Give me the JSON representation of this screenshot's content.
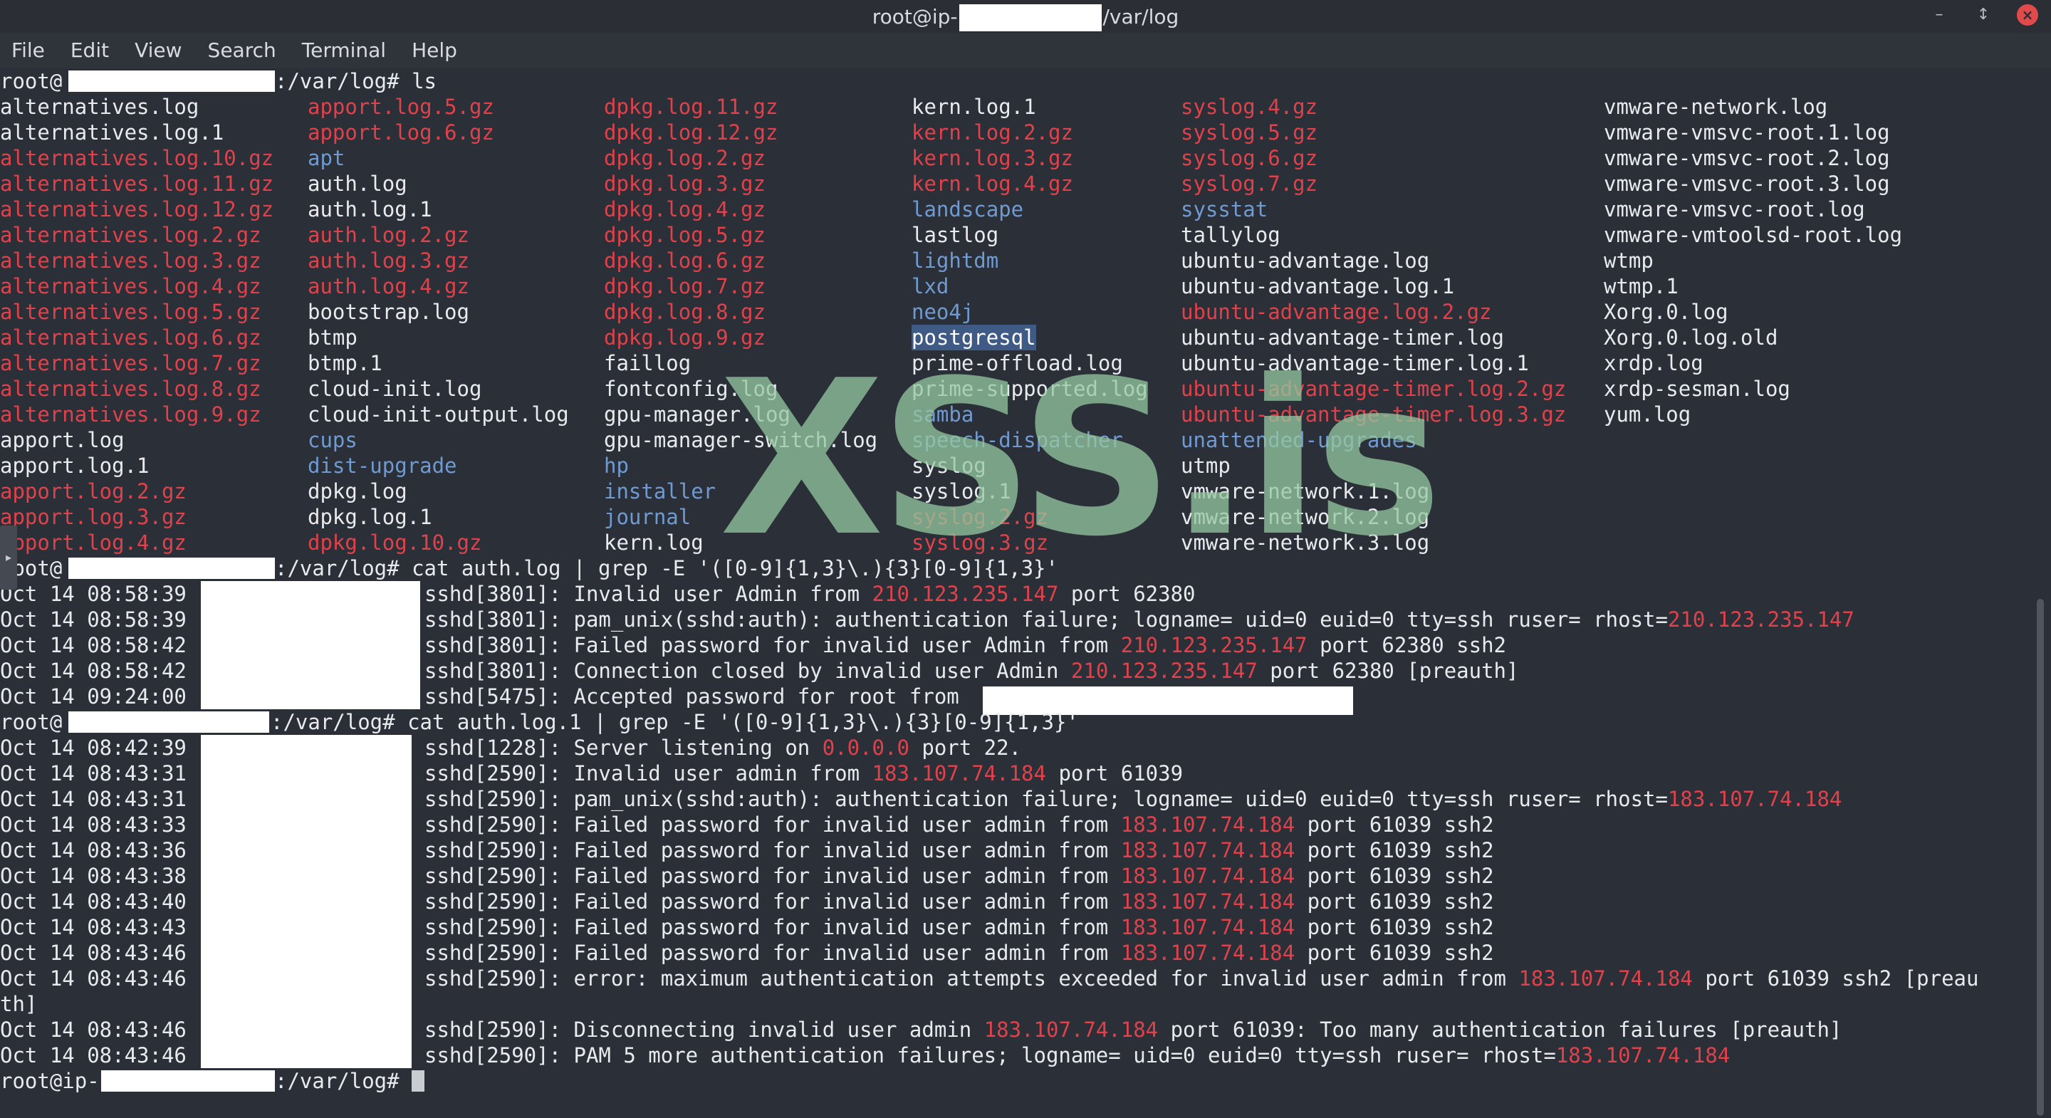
{
  "window": {
    "title_prefix": "root@ip-",
    "title_suffix": "/var/log",
    "minimize_glyph": "–",
    "maximize_glyph": "↕",
    "close_glyph": "×"
  },
  "menu": [
    "File",
    "Edit",
    "View",
    "Search",
    "Terminal",
    "Help"
  ],
  "colors": {
    "background": "#2b3038",
    "text": "#e8eaed",
    "red": "#e0414a",
    "blue": "#6f9ad2",
    "selection": "#3f5a85"
  },
  "watermark": "XSS.is",
  "ls_prompt": {
    "user": "root@",
    "path": ":/var/log",
    "hash": "# ",
    "command": "ls"
  },
  "ls_columns": [
    [
      {
        "t": "alternatives.log",
        "c": "w"
      },
      {
        "t": "alternatives.log.1",
        "c": "w"
      },
      {
        "t": "alternatives.log.10.gz",
        "c": "r"
      },
      {
        "t": "alternatives.log.11.gz",
        "c": "r"
      },
      {
        "t": "alternatives.log.12.gz",
        "c": "r"
      },
      {
        "t": "alternatives.log.2.gz",
        "c": "r"
      },
      {
        "t": "alternatives.log.3.gz",
        "c": "r"
      },
      {
        "t": "alternatives.log.4.gz",
        "c": "r"
      },
      {
        "t": "alternatives.log.5.gz",
        "c": "r"
      },
      {
        "t": "alternatives.log.6.gz",
        "c": "r"
      },
      {
        "t": "alternatives.log.7.gz",
        "c": "r"
      },
      {
        "t": "alternatives.log.8.gz",
        "c": "r"
      },
      {
        "t": "alternatives.log.9.gz",
        "c": "r"
      },
      {
        "t": "apport.log",
        "c": "w"
      },
      {
        "t": "apport.log.1",
        "c": "w"
      },
      {
        "t": "apport.log.2.gz",
        "c": "r"
      },
      {
        "t": "apport.log.3.gz",
        "c": "r"
      },
      {
        "t": "apport.log.4.gz",
        "c": "r"
      }
    ],
    [
      {
        "t": "apport.log.5.gz",
        "c": "r"
      },
      {
        "t": "apport.log.6.gz",
        "c": "r"
      },
      {
        "t": "apt",
        "c": "b"
      },
      {
        "t": "auth.log",
        "c": "w"
      },
      {
        "t": "auth.log.1",
        "c": "w"
      },
      {
        "t": "auth.log.2.gz",
        "c": "r"
      },
      {
        "t": "auth.log.3.gz",
        "c": "r"
      },
      {
        "t": "auth.log.4.gz",
        "c": "r"
      },
      {
        "t": "bootstrap.log",
        "c": "w"
      },
      {
        "t": "btmp",
        "c": "w"
      },
      {
        "t": "btmp.1",
        "c": "w"
      },
      {
        "t": "cloud-init.log",
        "c": "w"
      },
      {
        "t": "cloud-init-output.log",
        "c": "w"
      },
      {
        "t": "cups",
        "c": "b"
      },
      {
        "t": "dist-upgrade",
        "c": "b"
      },
      {
        "t": "dpkg.log",
        "c": "w"
      },
      {
        "t": "dpkg.log.1",
        "c": "w"
      },
      {
        "t": "dpkg.log.10.gz",
        "c": "r"
      }
    ],
    [
      {
        "t": "dpkg.log.11.gz",
        "c": "r"
      },
      {
        "t": "dpkg.log.12.gz",
        "c": "r"
      },
      {
        "t": "dpkg.log.2.gz",
        "c": "r"
      },
      {
        "t": "dpkg.log.3.gz",
        "c": "r"
      },
      {
        "t": "dpkg.log.4.gz",
        "c": "r"
      },
      {
        "t": "dpkg.log.5.gz",
        "c": "r"
      },
      {
        "t": "dpkg.log.6.gz",
        "c": "r"
      },
      {
        "t": "dpkg.log.7.gz",
        "c": "r"
      },
      {
        "t": "dpkg.log.8.gz",
        "c": "r"
      },
      {
        "t": "dpkg.log.9.gz",
        "c": "r"
      },
      {
        "t": "faillog",
        "c": "w"
      },
      {
        "t": "fontconfig.log",
        "c": "w"
      },
      {
        "t": "gpu-manager.log",
        "c": "w"
      },
      {
        "t": "gpu-manager-switch.log",
        "c": "w"
      },
      {
        "t": "hp",
        "c": "b"
      },
      {
        "t": "installer",
        "c": "b"
      },
      {
        "t": "journal",
        "c": "b"
      },
      {
        "t": "kern.log",
        "c": "w"
      }
    ],
    [
      {
        "t": "kern.log.1",
        "c": "w"
      },
      {
        "t": "kern.log.2.gz",
        "c": "r"
      },
      {
        "t": "kern.log.3.gz",
        "c": "r"
      },
      {
        "t": "kern.log.4.gz",
        "c": "r"
      },
      {
        "t": "landscape",
        "c": "b"
      },
      {
        "t": "lastlog",
        "c": "w"
      },
      {
        "t": "lightdm",
        "c": "b"
      },
      {
        "t": "lxd",
        "c": "b"
      },
      {
        "t": "neo4j",
        "c": "b"
      },
      {
        "t": "postgresql",
        "c": "sel"
      },
      {
        "t": "prime-offload.log",
        "c": "w"
      },
      {
        "t": "prime-supported.log",
        "c": "w"
      },
      {
        "t": "samba",
        "c": "b"
      },
      {
        "t": "speech-dispatcher",
        "c": "b"
      },
      {
        "t": "syslog",
        "c": "w"
      },
      {
        "t": "syslog.1",
        "c": "w"
      },
      {
        "t": "syslog.2.gz",
        "c": "r"
      },
      {
        "t": "syslog.3.gz",
        "c": "r"
      }
    ],
    [
      {
        "t": "syslog.4.gz",
        "c": "r"
      },
      {
        "t": "syslog.5.gz",
        "c": "r"
      },
      {
        "t": "syslog.6.gz",
        "c": "r"
      },
      {
        "t": "syslog.7.gz",
        "c": "r"
      },
      {
        "t": "sysstat",
        "c": "b"
      },
      {
        "t": "tallylog",
        "c": "w"
      },
      {
        "t": "ubuntu-advantage.log",
        "c": "w"
      },
      {
        "t": "ubuntu-advantage.log.1",
        "c": "w"
      },
      {
        "t": "ubuntu-advantage.log.2.gz",
        "c": "r"
      },
      {
        "t": "ubuntu-advantage-timer.log",
        "c": "w"
      },
      {
        "t": "ubuntu-advantage-timer.log.1",
        "c": "w"
      },
      {
        "t": "ubuntu-advantage-timer.log.2.gz",
        "c": "r"
      },
      {
        "t": "ubuntu-advantage-timer.log.3.gz",
        "c": "r"
      },
      {
        "t": "unattended-upgrades",
        "c": "b"
      },
      {
        "t": "utmp",
        "c": "w"
      },
      {
        "t": "vmware-network.1.log",
        "c": "w"
      },
      {
        "t": "vmware-network.2.log",
        "c": "w"
      },
      {
        "t": "vmware-network.3.log",
        "c": "w"
      }
    ],
    [
      {
        "t": "vmware-network.log",
        "c": "w"
      },
      {
        "t": "vmware-vmsvc-root.1.log",
        "c": "w"
      },
      {
        "t": "vmware-vmsvc-root.2.log",
        "c": "w"
      },
      {
        "t": "vmware-vmsvc-root.3.log",
        "c": "w"
      },
      {
        "t": "vmware-vmsvc-root.log",
        "c": "w"
      },
      {
        "t": "vmware-vmtoolsd-root.log",
        "c": "w"
      },
      {
        "t": "wtmp",
        "c": "w"
      },
      {
        "t": "wtmp.1",
        "c": "w"
      },
      {
        "t": "Xorg.0.log",
        "c": "w"
      },
      {
        "t": "Xorg.0.log.old",
        "c": "w"
      },
      {
        "t": "xrdp.log",
        "c": "w"
      },
      {
        "t": "xrdp-sesman.log",
        "c": "w"
      },
      {
        "t": "yum.log",
        "c": "w"
      }
    ]
  ],
  "grep1_prompt": {
    "user": "root@",
    "path": ":/var/log",
    "hash": "# ",
    "command": "cat auth.log | grep -E '([0-9]{1,3}\\.){3}[0-9]{1,3}'"
  },
  "grep1_lines": [
    {
      "ts": "Oct 14 08:58:39",
      "segs": [
        {
          "t": "sshd[3801]: Invalid user Admin from ",
          "c": "w"
        },
        {
          "t": "210.123.235.147",
          "c": "r"
        },
        {
          "t": " port 62380",
          "c": "w"
        }
      ]
    },
    {
      "ts": "Oct 14 08:58:39",
      "segs": [
        {
          "t": "sshd[3801]: pam_unix(sshd:auth): authentication failure; logname= uid=0 euid=0 tty=ssh ruser= rhost=",
          "c": "w"
        },
        {
          "t": "210.123.235.147",
          "c": "r"
        }
      ]
    },
    {
      "ts": "Oct 14 08:58:42",
      "segs": [
        {
          "t": "sshd[3801]: Failed password for invalid user Admin from ",
          "c": "w"
        },
        {
          "t": "210.123.235.147",
          "c": "r"
        },
        {
          "t": " port 62380 ssh2",
          "c": "w"
        }
      ]
    },
    {
      "ts": "Oct 14 08:58:42",
      "segs": [
        {
          "t": "sshd[3801]: Connection closed by invalid user Admin ",
          "c": "w"
        },
        {
          "t": "210.123.235.147",
          "c": "r"
        },
        {
          "t": " port 62380 [preauth]",
          "c": "w"
        }
      ]
    },
    {
      "ts": "Oct 14 09:24:00",
      "segs": [
        {
          "t": "sshd[5475]: Accepted password for root from ",
          "c": "w"
        }
      ]
    }
  ],
  "grep2_prompt": {
    "user": "root@",
    "path": ":/var/log",
    "hash": "# ",
    "command": "cat auth.log.1 | grep -E '([0-9]{1,3}\\.){3}[0-9]{1,3}'"
  },
  "grep2_lines": [
    {
      "ts": "Oct 14 08:42:39",
      "segs": [
        {
          "t": "sshd[1228]: Server listening on ",
          "c": "w"
        },
        {
          "t": "0.0.0.0",
          "c": "r"
        },
        {
          "t": " port 22.",
          "c": "w"
        }
      ]
    },
    {
      "ts": "Oct 14 08:43:31",
      "segs": [
        {
          "t": "sshd[2590]: Invalid user admin from ",
          "c": "w"
        },
        {
          "t": "183.107.74.184",
          "c": "r"
        },
        {
          "t": " port 61039",
          "c": "w"
        }
      ]
    },
    {
      "ts": "Oct 14 08:43:31",
      "segs": [
        {
          "t": "sshd[2590]: pam_unix(sshd:auth): authentication failure; logname= uid=0 euid=0 tty=ssh ruser= rhost=",
          "c": "w"
        },
        {
          "t": "183.107.74.184",
          "c": "r"
        }
      ]
    },
    {
      "ts": "Oct 14 08:43:33",
      "segs": [
        {
          "t": "sshd[2590]: Failed password for invalid user admin from ",
          "c": "w"
        },
        {
          "t": "183.107.74.184",
          "c": "r"
        },
        {
          "t": " port 61039 ssh2",
          "c": "w"
        }
      ]
    },
    {
      "ts": "Oct 14 08:43:36",
      "segs": [
        {
          "t": "sshd[2590]: Failed password for invalid user admin from ",
          "c": "w"
        },
        {
          "t": "183.107.74.184",
          "c": "r"
        },
        {
          "t": " port 61039 ssh2",
          "c": "w"
        }
      ]
    },
    {
      "ts": "Oct 14 08:43:38",
      "segs": [
        {
          "t": "sshd[2590]: Failed password for invalid user admin from ",
          "c": "w"
        },
        {
          "t": "183.107.74.184",
          "c": "r"
        },
        {
          "t": " port 61039 ssh2",
          "c": "w"
        }
      ]
    },
    {
      "ts": "Oct 14 08:43:40",
      "segs": [
        {
          "t": "sshd[2590]: Failed password for invalid user admin from ",
          "c": "w"
        },
        {
          "t": "183.107.74.184",
          "c": "r"
        },
        {
          "t": " port 61039 ssh2",
          "c": "w"
        }
      ]
    },
    {
      "ts": "Oct 14 08:43:43",
      "segs": [
        {
          "t": "sshd[2590]: Failed password for invalid user admin from ",
          "c": "w"
        },
        {
          "t": "183.107.74.184",
          "c": "r"
        },
        {
          "t": " port 61039 ssh2",
          "c": "w"
        }
      ]
    },
    {
      "ts": "Oct 14 08:43:46",
      "segs": [
        {
          "t": "sshd[2590]: Failed password for invalid user admin from ",
          "c": "w"
        },
        {
          "t": "183.107.74.184",
          "c": "r"
        },
        {
          "t": " port 61039 ssh2",
          "c": "w"
        }
      ]
    },
    {
      "ts": "Oct 14 08:43:46",
      "segs": [
        {
          "t": "sshd[2590]: error: maximum authentication attempts exceeded for invalid user admin from ",
          "c": "w"
        },
        {
          "t": "183.107.74.184",
          "c": "r"
        },
        {
          "t": " port 61039 ssh2 [preau",
          "c": "w"
        }
      ]
    },
    {
      "ts": "",
      "segs": [
        {
          "t": "th]",
          "c": "w"
        }
      ]
    },
    {
      "ts": "Oct 14 08:43:46",
      "segs": [
        {
          "t": "sshd[2590]: Disconnecting invalid user admin ",
          "c": "w"
        },
        {
          "t": "183.107.74.184",
          "c": "r"
        },
        {
          "t": " port 61039: Too many authentication failures [preauth]",
          "c": "w"
        }
      ]
    },
    {
      "ts": "Oct 14 08:43:46",
      "segs": [
        {
          "t": "sshd[2590]: PAM 5 more authentication failures; logname= uid=0 euid=0 tty=ssh ruser= rhost=",
          "c": "w"
        },
        {
          "t": "183.107.74.184",
          "c": "r"
        }
      ]
    }
  ],
  "final_prompt": {
    "user": "root@ip-",
    "path": ":/var/log",
    "hash": "# "
  }
}
